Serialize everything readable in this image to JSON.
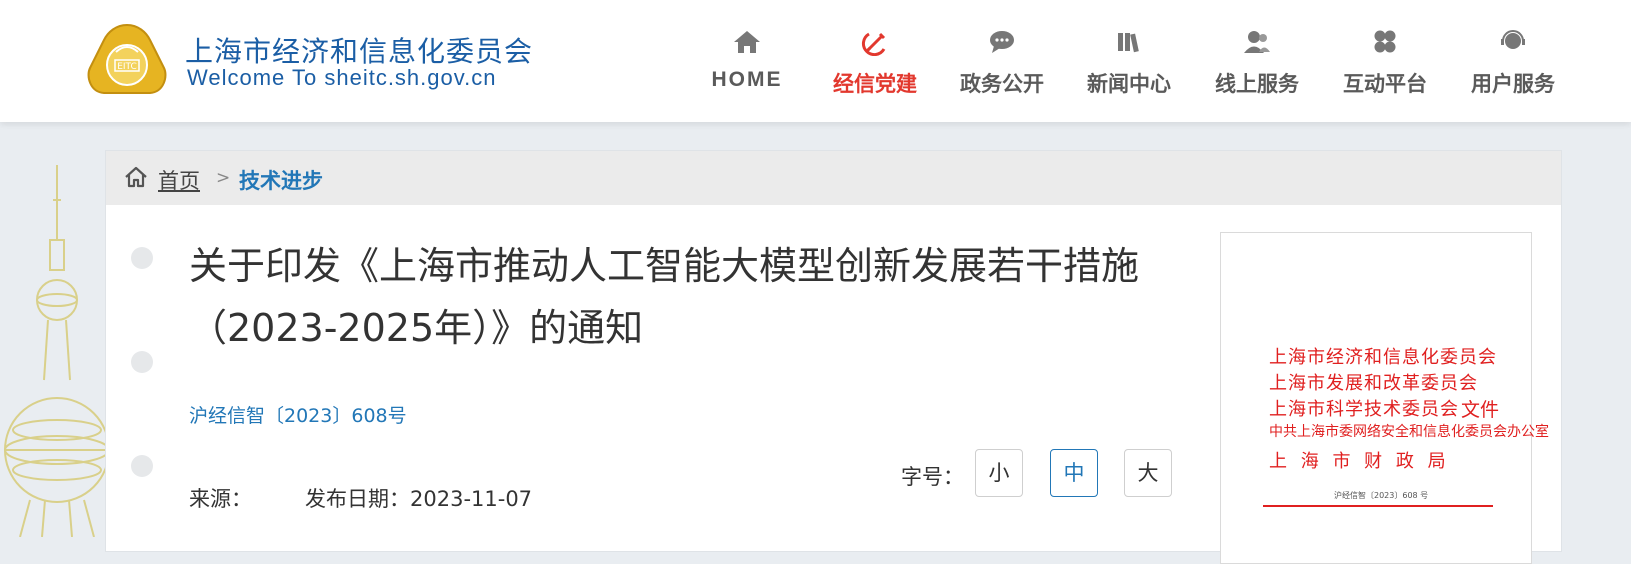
{
  "header": {
    "logo_title": "上海市经济和信息化委员会",
    "logo_subtitle": "Welcome To sheitc.sh.gov.cn",
    "logo_emblem_text": "EITC"
  },
  "nav": [
    {
      "label": "HOME",
      "icon": "home-icon"
    },
    {
      "label": "经信党建",
      "icon": "party-emblem-icon",
      "active": true
    },
    {
      "label": "政务公开",
      "icon": "chat-bubble-icon"
    },
    {
      "label": "新闻中心",
      "icon": "books-icon"
    },
    {
      "label": "线上服务",
      "icon": "users-icon"
    },
    {
      "label": "互动平台",
      "icon": "clover-icon"
    },
    {
      "label": "用户服务",
      "icon": "user-service-icon"
    }
  ],
  "breadcrumb": {
    "home": "首页",
    "separator": ">",
    "current": "技术进步"
  },
  "article": {
    "title": "关于印发《上海市推动人工智能大模型创新发展若干措施（2023-2025年）》的通知",
    "doc_number": "沪经信智〔2023〕608号",
    "source_label": "来源：",
    "date_label": "发布日期：",
    "date": "2023-11-07"
  },
  "font_size": {
    "label": "字号：",
    "small": "小",
    "medium": "中",
    "large": "大",
    "selected": "中"
  },
  "document_thumbnail": {
    "lines": [
      "上海市经济和信息化委员会",
      "上海市发展和改革委员会",
      "上海市科学技术委员会",
      "中共上海市委网络安全和信息化委员会办公室",
      "上 海 市 财 政 局"
    ],
    "file_label": "文件",
    "doc_no": "沪经信智〔2023〕608 号"
  },
  "colors": {
    "brand_blue": "#1b5ea5",
    "link_blue": "#2277b7",
    "active_red": "#e2382e",
    "doc_red": "#e02020",
    "nav_gray": "#5a5a5a",
    "emblem_gold": "#e6b422"
  }
}
